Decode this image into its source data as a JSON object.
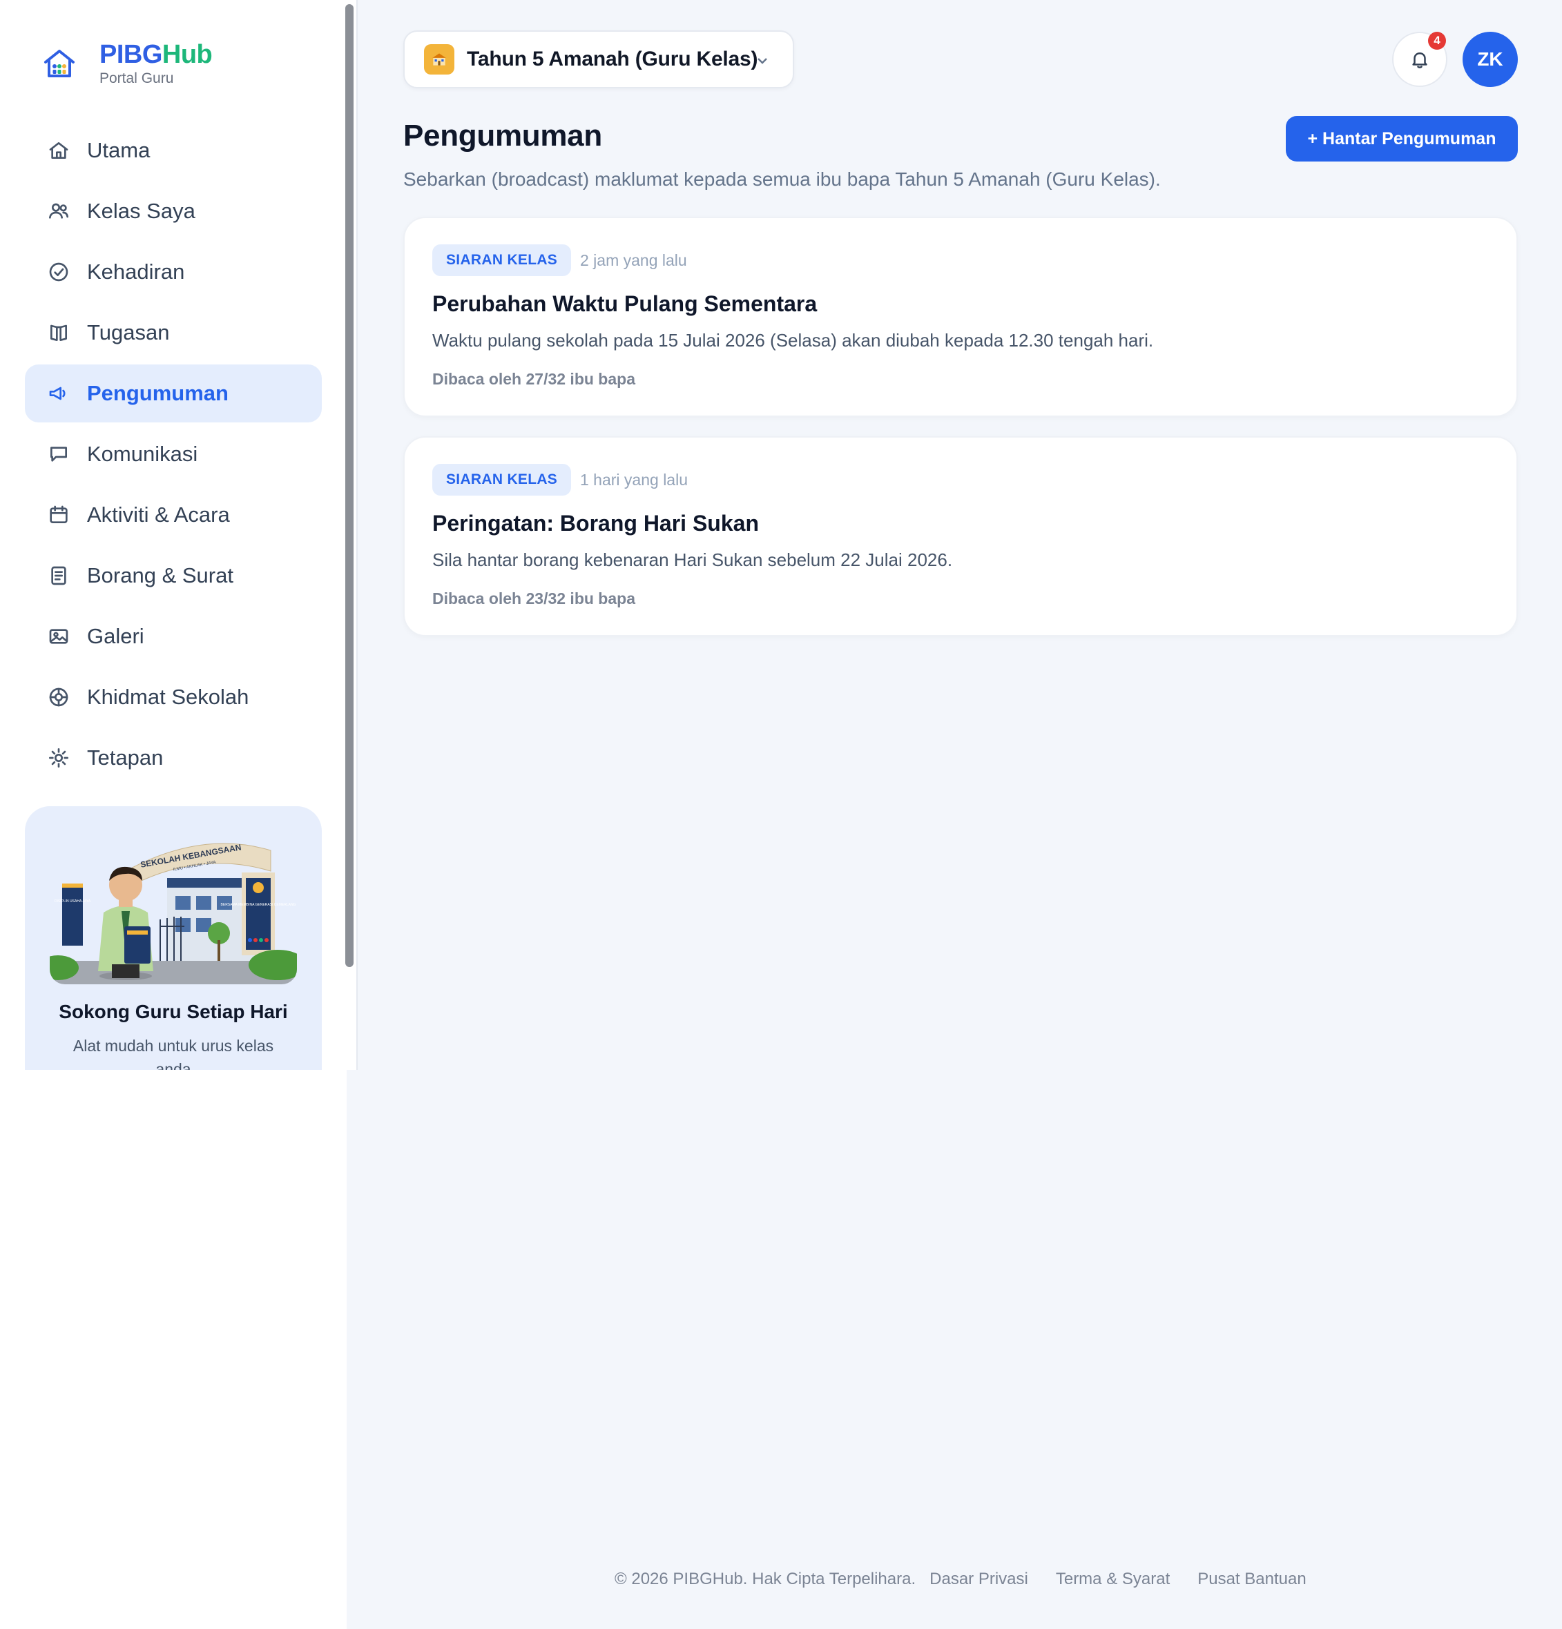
{
  "brand": {
    "name_part1": "PIBG",
    "name_part2": "Hub",
    "subtitle": "Portal Guru",
    "colors": {
      "primary": "#2f5fe3",
      "accent": "#1db77a"
    }
  },
  "sidebar": {
    "items": [
      {
        "label": "Utama",
        "icon": "home-icon",
        "active": false
      },
      {
        "label": "Kelas Saya",
        "icon": "users-icon",
        "active": false
      },
      {
        "label": "Kehadiran",
        "icon": "check-circle-icon",
        "active": false
      },
      {
        "label": "Tugasan",
        "icon": "book-icon",
        "active": false
      },
      {
        "label": "Pengumuman",
        "icon": "megaphone-icon",
        "active": true
      },
      {
        "label": "Komunikasi",
        "icon": "chat-icon",
        "active": false
      },
      {
        "label": "Aktiviti & Acara",
        "icon": "calendar-icon",
        "active": false
      },
      {
        "label": "Borang & Surat",
        "icon": "document-icon",
        "active": false
      },
      {
        "label": "Galeri",
        "icon": "image-icon",
        "active": false
      },
      {
        "label": "Khidmat Sekolah",
        "icon": "lifebuoy-icon",
        "active": false
      },
      {
        "label": "Tetapan",
        "icon": "settings-icon",
        "active": false
      }
    ],
    "promo": {
      "title": "Sokong Guru Setiap Hari",
      "subtitle": "Alat mudah untuk urus kelas anda",
      "illustration": {
        "gate_sign": "SEKOLAH KEBANGSAAN",
        "gate_motto": "ILMU • AKHLAK • JAYA",
        "left_banner": "DISIPLIN USAHA JAYA",
        "right_banner": "BERSAMA MEMBINA GENERASI CEMERLANG"
      }
    }
  },
  "header": {
    "class_selector": {
      "label": "Tahun 5 Amanah (Guru Kelas)",
      "icon": "school-icon"
    },
    "notifications": {
      "count": "4",
      "icon": "bell-icon"
    },
    "avatar": {
      "initials": "ZK",
      "color": "#2563eb"
    }
  },
  "page": {
    "title": "Pengumuman",
    "description": "Sebarkan (broadcast) maklumat kepada semua ibu bapa Tahun 5 Amanah (Guru Kelas).",
    "primary_button": "+ Hantar Pengumuman"
  },
  "announcements": [
    {
      "tag": "SIARAN KELAS",
      "time": "2 jam yang lalu",
      "title": "Perubahan Waktu Pulang Sementara",
      "body": "Waktu pulang sekolah pada 15 Julai 2026 (Selasa) akan diubah kepada 12.30 tengah hari.",
      "reads": "Dibaca oleh 27/32 ibu bapa"
    },
    {
      "tag": "SIARAN KELAS",
      "time": "1 hari yang lalu",
      "title": "Peringatan: Borang Hari Sukan",
      "body": "Sila hantar borang kebenaran Hari Sukan sebelum 22 Julai 2026.",
      "reads": "Dibaca oleh 23/32 ibu bapa"
    }
  ],
  "footer": {
    "copyright": "© 2026 PIBGHub. Hak Cipta Terpelihara.",
    "links": [
      "Dasar Privasi",
      "Terma & Syarat",
      "Pusat Bantuan"
    ]
  }
}
